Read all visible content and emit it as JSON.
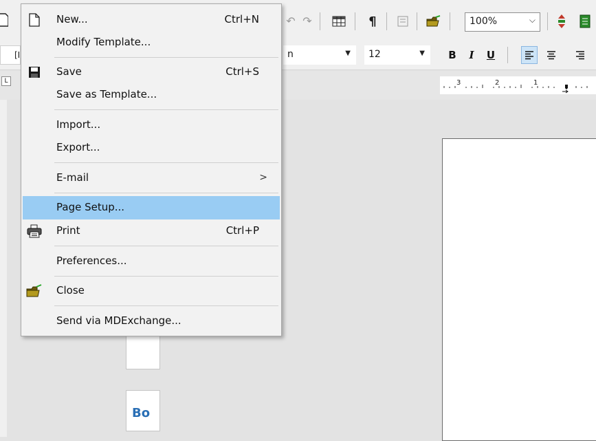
{
  "toolbar": {
    "zoom_value": "100%",
    "font_name_fragment": "n",
    "font_size": "12",
    "left_fragment": "[I",
    "bold_label": "B",
    "italic_label": "I",
    "underline_label": "U"
  },
  "ruler": {
    "numbers": [
      "3",
      "2",
      "1"
    ]
  },
  "document": {
    "text_fragment": "Bo"
  },
  "file_menu": {
    "items": [
      {
        "label": "New...",
        "shortcut": "Ctrl+N",
        "icon": "new-document-icon"
      },
      {
        "label": "Modify Template...",
        "shortcut": "",
        "icon": ""
      },
      {
        "label": "Save",
        "shortcut": "Ctrl+S",
        "icon": "save-icon"
      },
      {
        "label": "Save as Template...",
        "shortcut": "",
        "icon": ""
      },
      {
        "label": "Import...",
        "shortcut": "",
        "icon": ""
      },
      {
        "label": "Export...",
        "shortcut": "",
        "icon": ""
      },
      {
        "label": "E-mail",
        "shortcut": "",
        "icon": "",
        "submenu_arrow": ">"
      },
      {
        "label": "Page Setup...",
        "shortcut": "",
        "icon": "",
        "highlighted": true
      },
      {
        "label": "Print",
        "shortcut": "Ctrl+P",
        "icon": "printer-icon"
      },
      {
        "label": "Preferences...",
        "shortcut": "",
        "icon": ""
      },
      {
        "label": "Close",
        "shortcut": "",
        "icon": "close-folder-icon"
      },
      {
        "label": "Send via MDExchange...",
        "shortcut": "",
        "icon": ""
      }
    ]
  },
  "colors": {
    "highlight": "#99ccf3",
    "menu_bg": "#f2f2f2",
    "toolbar_bg": "#f0f0f0",
    "workspace_bg": "#e3e3e3",
    "accent_text": "#2a6fb5"
  }
}
